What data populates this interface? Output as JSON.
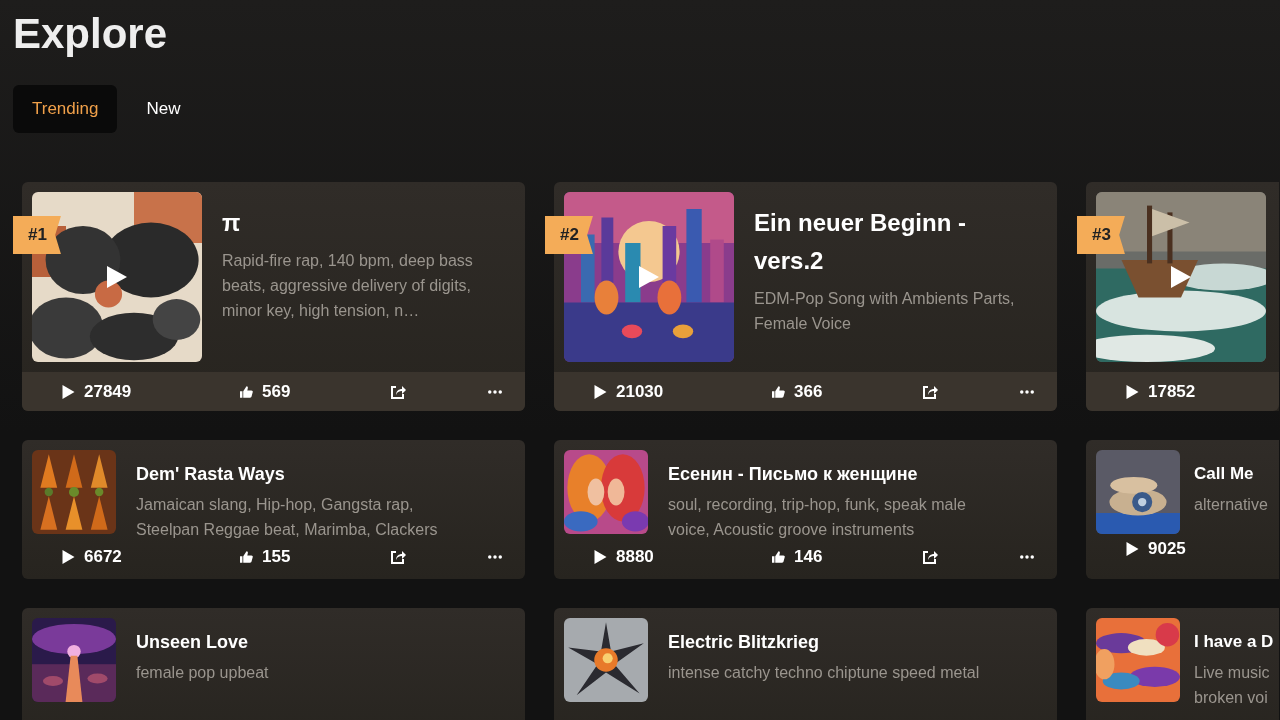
{
  "page": {
    "title": "Explore"
  },
  "tabs": [
    {
      "label": "Trending",
      "selected": true
    },
    {
      "label": "New",
      "selected": false
    }
  ],
  "rows": [
    {
      "kind": "featured",
      "songs": [
        {
          "rank": "#1",
          "title": "π",
          "description": "Rapid-fire rap, 140 bpm, deep bass beats, aggressive delivery of digits, minor key, high tension, n…",
          "plays": "27849",
          "likes": "569"
        },
        {
          "rank": "#2",
          "title": "Ein neuer Beginn - vers.2",
          "description": "EDM-Pop Song with Ambients Parts, Female Voice",
          "plays": "21030",
          "likes": "366"
        },
        {
          "rank": "#3",
          "plays": "17852"
        }
      ]
    },
    {
      "kind": "compact",
      "songs": [
        {
          "title": "Dem' Rasta Ways",
          "description": "Jamaican slang, Hip-hop, Gangsta rap, Steelpan Reggae beat, Marimba, Clackers",
          "plays": "6672",
          "likes": "155"
        },
        {
          "title": "Есенин - Письмо к женщине",
          "description": "soul, recording, trip-hop, funk, speak male voice, Acoustic groove instruments",
          "plays": "8880",
          "likes": "146"
        },
        {
          "title": "Call Me",
          "description": "alternative",
          "plays": "9025"
        }
      ]
    },
    {
      "kind": "compact",
      "songs": [
        {
          "title": "Unseen Love",
          "description": "female pop upbeat"
        },
        {
          "title": "Electric Blitzkrieg",
          "description": "intense catchy techno chiptune speed metal"
        },
        {
          "title": "I have a D",
          "description": "Live music broken voi"
        }
      ]
    }
  ]
}
